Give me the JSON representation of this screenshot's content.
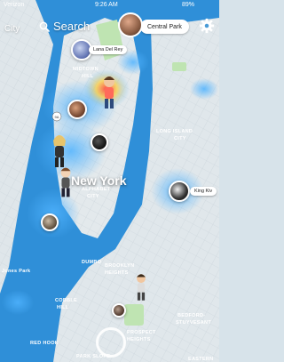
{
  "status_bar": {
    "carrier": "Verizon",
    "time": "9:26 AM",
    "battery": "89%"
  },
  "header": {
    "search_label": "Search",
    "city_left": "City",
    "top_pill_label": "Central Park"
  },
  "map_labels": {
    "city_name": "New York",
    "neighborhoods": [
      "MIDTOWN",
      "HILL",
      "LONG ISLAND",
      "CITY",
      "ALPHABET",
      "CITY",
      "DUMBO",
      "BROOKLYN",
      "HEIGHTS",
      "COBBLE",
      "HILL",
      "RED HOOK",
      "PARK SLOPE",
      "PROSPECT",
      "HEIGHTS",
      "BEDFORD-",
      "STUYVESANT",
      "EASTERN",
      "Jones Park"
    ],
    "road_badge": "9A"
  },
  "stories": [
    {
      "label": "Lana Del Rey"
    },
    {
      "label": "King Kiv"
    }
  ],
  "colors": {
    "water": "#2f8fd8",
    "land": "#d9e1e6",
    "park": "#bfe4b2",
    "heat_blue": "#58b6ff",
    "heat_red": "#ff4a55"
  },
  "icons": [
    "search-icon",
    "gear-icon",
    "camera-button-icon"
  ]
}
